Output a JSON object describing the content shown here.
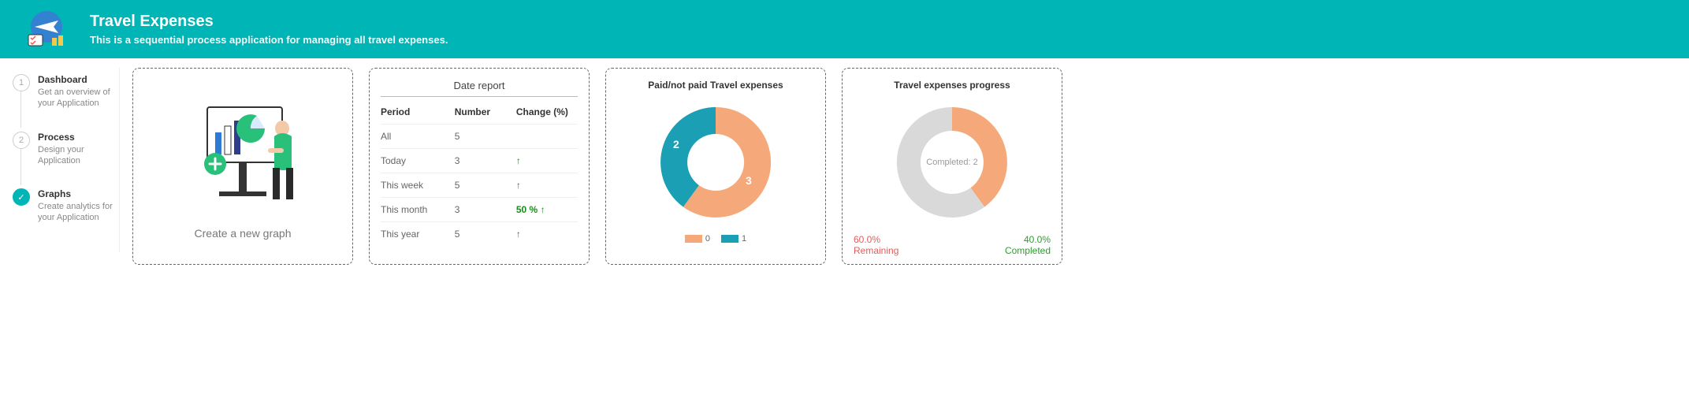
{
  "header": {
    "title": "Travel Expenses",
    "subtitle": "This is a sequential process application for managing all travel expenses."
  },
  "sidebar": {
    "steps": [
      {
        "num": "1",
        "title": "Dashboard",
        "desc": "Get an overview of your Application"
      },
      {
        "num": "2",
        "title": "Process",
        "desc": "Design your Application"
      },
      {
        "num": "✓",
        "title": "Graphs",
        "desc": "Create analytics for your Application"
      }
    ]
  },
  "create_card": {
    "label": "Create a new graph"
  },
  "report": {
    "title": "Date report",
    "columns": {
      "period": "Period",
      "number": "Number",
      "change": "Change (%)"
    },
    "rows": [
      {
        "period": "All",
        "number": "5",
        "change": "",
        "arrow": false
      },
      {
        "period": "Today",
        "number": "3",
        "change": "",
        "arrow": true
      },
      {
        "period": "This week",
        "number": "5",
        "change": "",
        "arrow": true
      },
      {
        "period": "This month",
        "number": "3",
        "change": "50 %",
        "arrow": true
      },
      {
        "period": "This year",
        "number": "5",
        "change": "",
        "arrow": true
      }
    ]
  },
  "paid_chart": {
    "title": "Paid/not paid Travel expenses",
    "legend": [
      {
        "label": "0",
        "color": "#f5a97a"
      },
      {
        "label": "1",
        "color": "#1a9fb5"
      }
    ]
  },
  "progress_chart": {
    "title": "Travel expenses progress",
    "center": "Completed: 2",
    "remaining_pct": "60.0%",
    "remaining_label": "Remaining",
    "completed_pct": "40.0%",
    "completed_label": "Completed"
  },
  "chart_data": [
    {
      "type": "pie",
      "title": "Paid/not paid Travel expenses",
      "series": [
        {
          "name": "0",
          "value": 3,
          "color": "#f5a97a"
        },
        {
          "name": "1",
          "value": 2,
          "color": "#1a9fb5"
        }
      ]
    },
    {
      "type": "pie",
      "title": "Travel expenses progress",
      "series": [
        {
          "name": "Completed",
          "value": 2,
          "percent": 40.0,
          "color": "#f5a97a"
        },
        {
          "name": "Remaining",
          "value": 3,
          "percent": 60.0,
          "color": "#d9d9d9"
        }
      ],
      "center_label": "Completed: 2"
    },
    {
      "type": "table",
      "title": "Date report",
      "columns": [
        "Period",
        "Number",
        "Change (%)"
      ],
      "rows": [
        [
          "All",
          5,
          null
        ],
        [
          "Today",
          3,
          null
        ],
        [
          "This week",
          5,
          null
        ],
        [
          "This month",
          3,
          50
        ],
        [
          "This year",
          5,
          null
        ]
      ]
    }
  ]
}
